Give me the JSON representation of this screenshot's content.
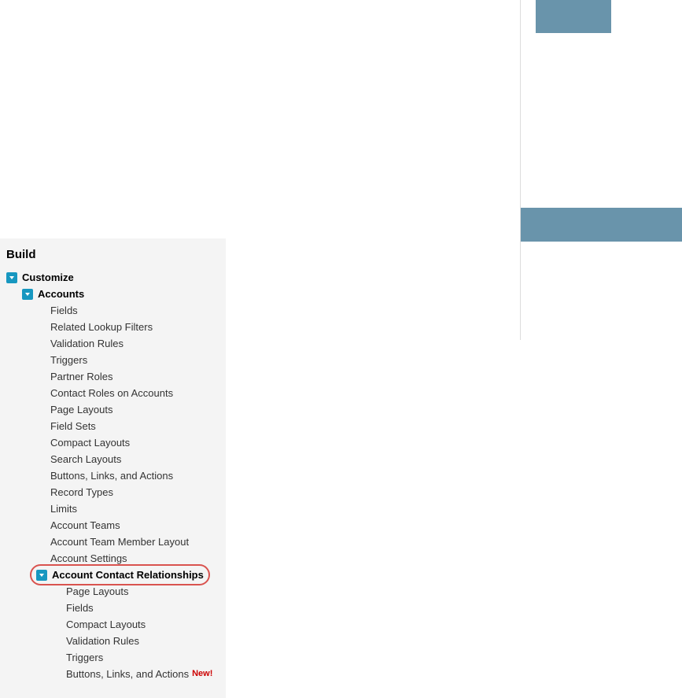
{
  "sidebar": {
    "build_header": "Build",
    "customize": "Customize",
    "accounts": {
      "label": "Accounts",
      "items": [
        "Fields",
        "Related Lookup Filters",
        "Validation Rules",
        "Triggers",
        "Partner Roles",
        "Contact Roles on Accounts",
        "Page Layouts",
        "Field Sets",
        "Compact Layouts",
        "Search Layouts",
        "Buttons, Links, and Actions",
        "Record Types",
        "Limits",
        "Account Teams",
        "Account Team Member Layout",
        "Account Settings"
      ],
      "acr": {
        "label": "Account Contact Relationships",
        "items": [
          "Page Layouts",
          "Fields",
          "Compact Layouts",
          "Validation Rules",
          "Triggers",
          "Buttons, Links, and Actions"
        ],
        "new_badge": "New!"
      }
    }
  }
}
